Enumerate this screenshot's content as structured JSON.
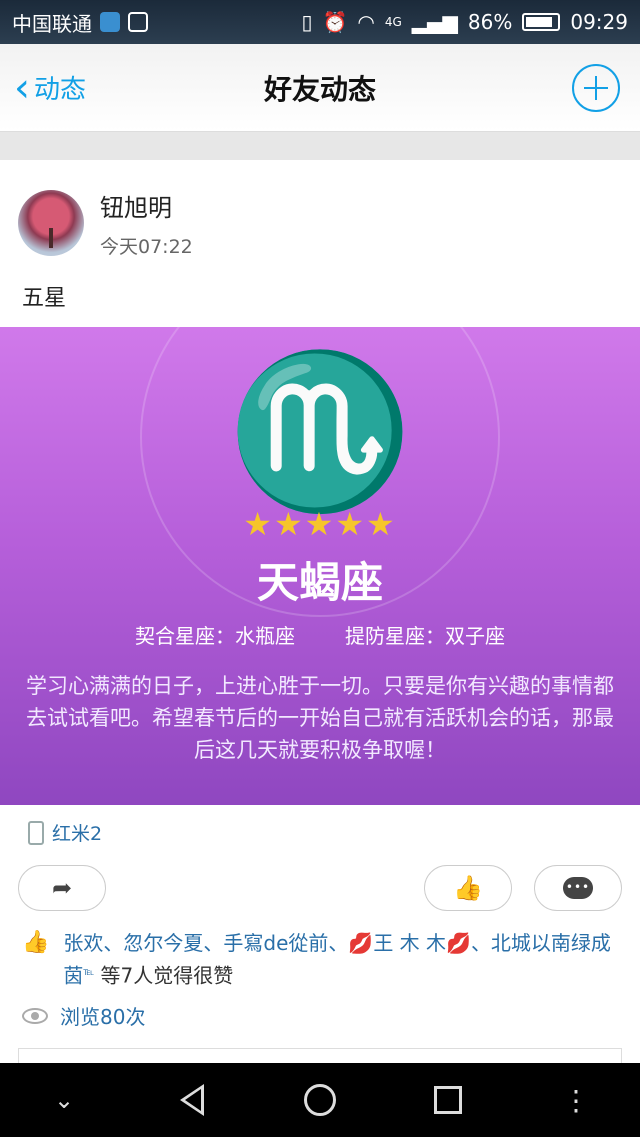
{
  "status_bar": {
    "carrier": "中国联通",
    "battery_percent": "86%",
    "time": "09:29",
    "network": "4G"
  },
  "header": {
    "back_label": "动态",
    "title": "好友动态"
  },
  "post": {
    "username": "钮旭明",
    "time": "今天07:22",
    "text": "五星",
    "banner": {
      "zodiac_glyph": "♏",
      "stars": "★★★★★",
      "star_rating": 5,
      "zodiac_name": "天蝎座",
      "match_label": "契合星座：水瓶座",
      "caution_label": "提防星座：双子座",
      "fortune_text": "学习心满满的日子，上进心胜于一切。只要是你有兴趣的事情都去试试看吧。希望春节后的一开始自己就有活跃机会的话，那最后这几天就要积极争取喔！"
    },
    "device": "红米2",
    "likes_names": "张欢、忽尔今夏、手寫de從前、",
    "likes_lips1": "💋",
    "likes_name_wang": "王 木 木",
    "likes_lips2": "💋",
    "likes_names2": "、北城以南绿成茵",
    "likes_tel": "℡",
    "likes_suffix": "等7人觉得很赞",
    "views": "浏览80次"
  },
  "colors": {
    "accent": "#12a0e6",
    "link": "#2a6fa8",
    "banner_top": "#d079ea",
    "banner_bottom": "#8f47c0",
    "star": "#f6c52a"
  }
}
